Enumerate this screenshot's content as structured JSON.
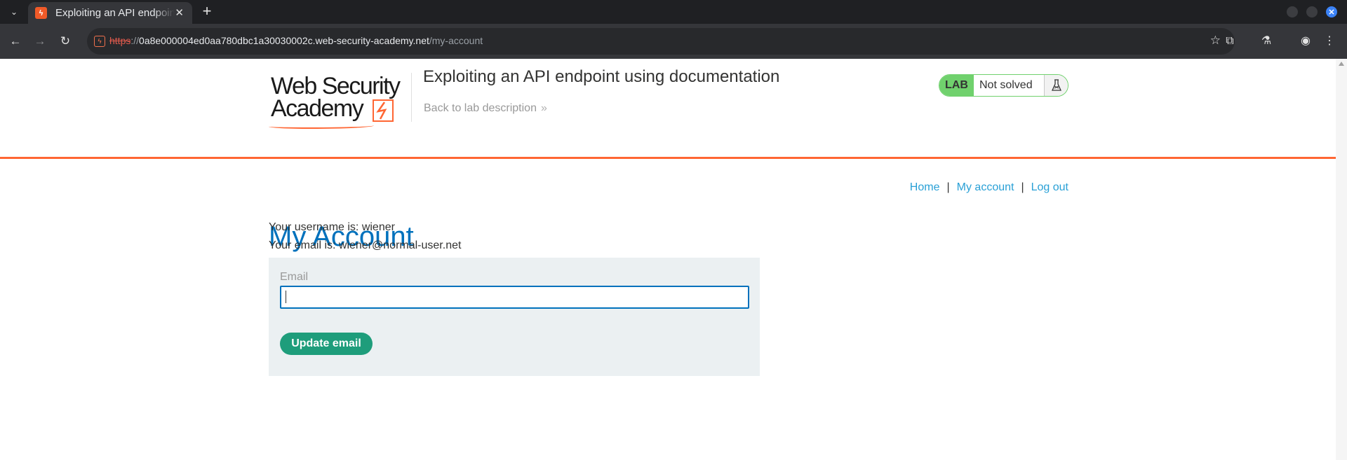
{
  "browser": {
    "tab": {
      "title": "Exploiting an API endpoint using documentation",
      "favicon": "ϟ",
      "close": "✕"
    },
    "new_tab": "+",
    "url": {
      "scheme": "https",
      "separator": "://",
      "host": "0a8e000004ed0aa780dbc1a30030002c.web-security-academy.net",
      "path": "/my-account"
    }
  },
  "header": {
    "logo_line1": "Web Security",
    "logo_line2": "Academy",
    "lab_title": "Exploiting an API endpoint using documentation",
    "back_link": "Back to lab description",
    "back_chevron": "»",
    "lab_badge": "LAB",
    "lab_state": "Not solved",
    "colors": {
      "accent": "#ff6633",
      "lab_green": "#70d16d",
      "link_blue": "#29a0d6",
      "heading_blue": "#0071bc",
      "button_green": "#1e9d7b"
    }
  },
  "nav": {
    "home": "Home",
    "sep1": "|",
    "my_account": "My account",
    "sep2": "|",
    "log_out": "Log out"
  },
  "account": {
    "heading": "My Account",
    "username_line": "Your username is: wiener",
    "email_line": "Your email is: wiener@normal-user.net",
    "form": {
      "email_label": "Email",
      "email_value": "",
      "submit_label": "Update email"
    }
  }
}
